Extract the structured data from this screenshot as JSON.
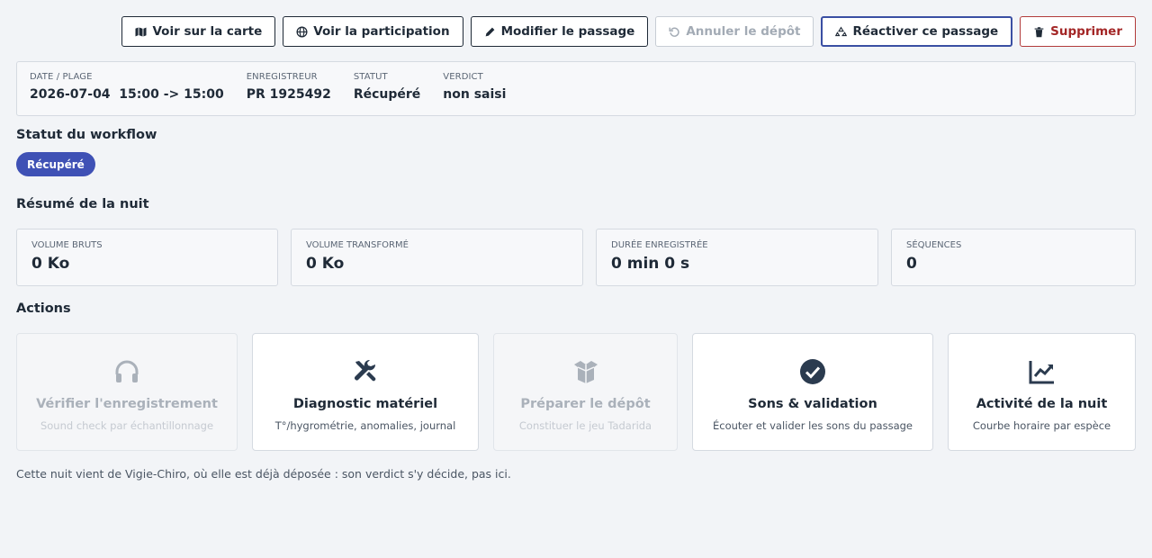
{
  "toolbar": {
    "map_label": "Voir sur la carte",
    "participation_label": "Voir la participation",
    "edit_label": "Modifier le passage",
    "cancel_deposit_label": "Annuler le dépôt",
    "reactivate_label": "Réactiver ce passage",
    "delete_label": "Supprimer"
  },
  "info": {
    "date_label": "Date / plage",
    "date_value": "2026-07-04  15:00 -> 15:00",
    "recorder_label": "Enregistreur",
    "recorder_value": "PR 1925492",
    "status_label": "Statut",
    "status_value": "Récupéré",
    "verdict_label": "Verdict",
    "verdict_value": "non saisi"
  },
  "workflow": {
    "heading": "Statut du workflow",
    "badge": "Récupéré",
    "badge_color": "#3f51b5"
  },
  "summary": {
    "heading": "Résumé de la nuit",
    "stats": [
      {
        "label": "Volume bruts",
        "value": "0 Ko"
      },
      {
        "label": "Volume transformé",
        "value": "0 Ko"
      },
      {
        "label": "Durée enregistrée",
        "value": "0 min 0 s"
      },
      {
        "label": "Séquences",
        "value": "0"
      }
    ]
  },
  "actions": {
    "heading": "Actions",
    "cards": [
      {
        "icon": "headphones-icon",
        "title": "Vérifier l'enregistrement",
        "subtitle": "Sound check par échantillonnage",
        "enabled": false
      },
      {
        "icon": "tools-icon",
        "title": "Diagnostic matériel",
        "subtitle": "T°/hygrométrie, anomalies, journal",
        "enabled": true
      },
      {
        "icon": "box-open-icon",
        "title": "Préparer le dépôt",
        "subtitle": "Constituer le jeu Tadarida",
        "enabled": false
      },
      {
        "icon": "check-circle-icon",
        "title": "Sons & validation",
        "subtitle": "Écouter et valider les sons du passage",
        "enabled": true
      },
      {
        "icon": "chart-line-icon",
        "title": "Activité de la nuit",
        "subtitle": "Courbe horaire par espèce",
        "enabled": true
      }
    ]
  },
  "note": "Cette nuit vient de Vigie-Chiro, où elle est déjà déposée : son verdict s'y décide, pas ici."
}
